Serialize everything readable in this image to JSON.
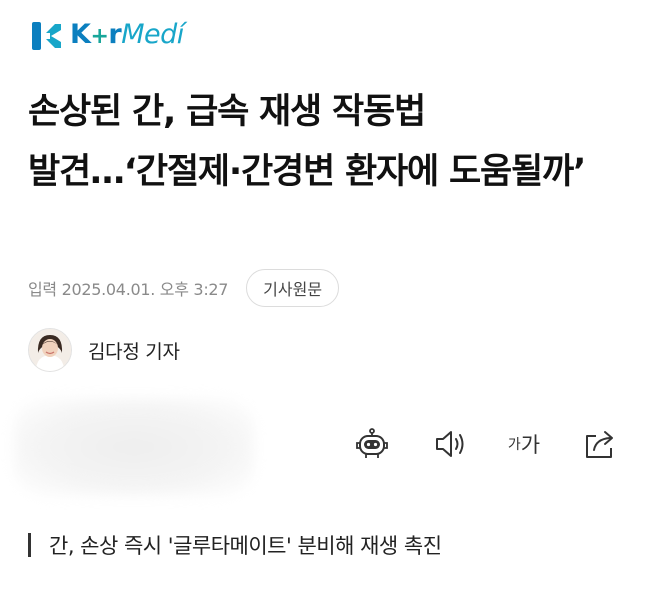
{
  "logo": {
    "k": "K",
    "plus": "+",
    "r": "r",
    "medi": "Medí",
    "icon": "kormedi-logo-mark"
  },
  "headline": "손상된 간, 급속 재생 작동법 발견…‘간절제·간경변 환자에 도움될까’",
  "meta": {
    "date": "입력 2025.04.01. 오후 3:27",
    "source_button": "기사원문"
  },
  "reporter": {
    "name": "김다정 기자",
    "avatar_icon": "reporter-avatar"
  },
  "toolbar": {
    "ai_icon": "robot-icon",
    "speaker_icon": "speaker-icon",
    "font_small": "가",
    "font_big": "가",
    "share_icon": "share-icon"
  },
  "subheading": "간, 손상 즉시 '글루타메이트' 분비해 재생 촉진",
  "colors": {
    "logo_blue": "#0b7fbf",
    "logo_teal": "#18a69a",
    "text": "#111111",
    "meta_gray": "#8a8a8a"
  }
}
